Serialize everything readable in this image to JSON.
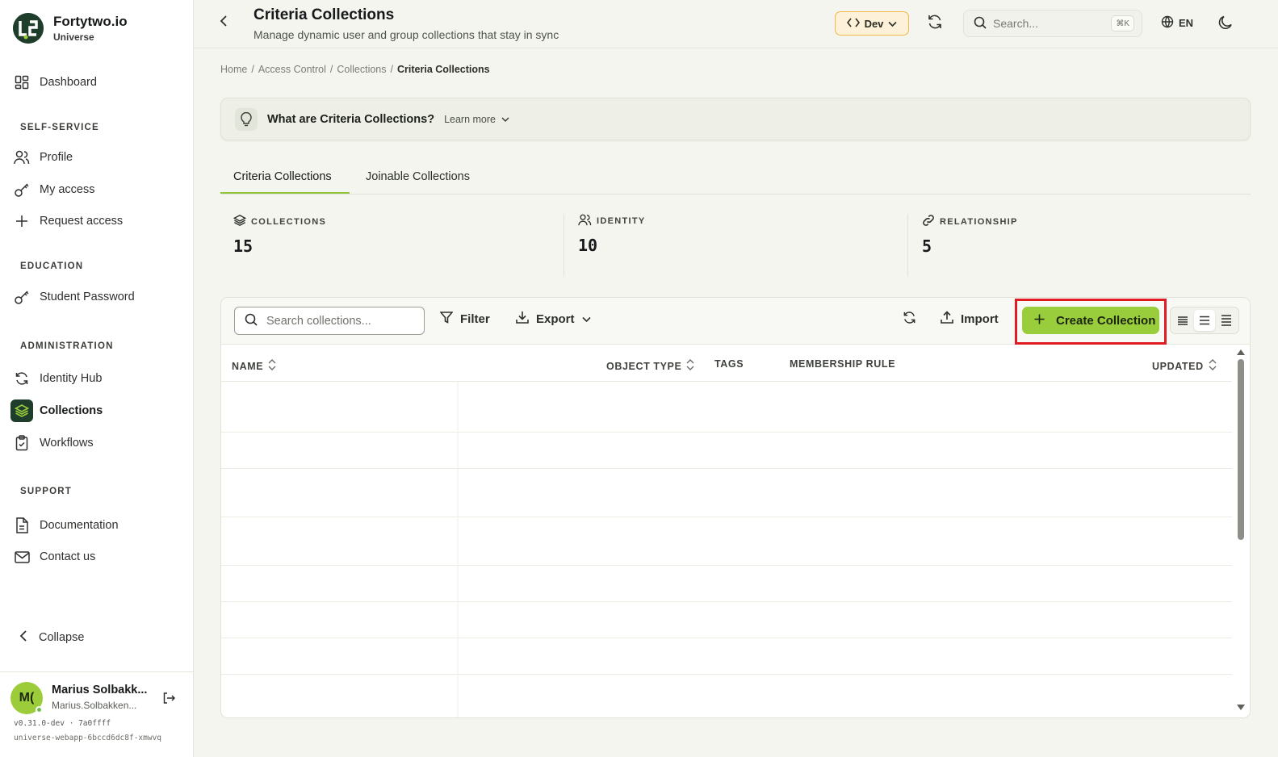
{
  "brand": {
    "name": "Fortytwo.io",
    "sub": "Universe"
  },
  "sidebar": {
    "dashboard": "Dashboard",
    "sections": {
      "self_service": "SELF-SERVICE",
      "education": "EDUCATION",
      "administration": "ADMINISTRATION",
      "support": "SUPPORT"
    },
    "items": {
      "profile": "Profile",
      "my_access": "My access",
      "request_access": "Request access",
      "student_password": "Student Password",
      "identity_hub": "Identity Hub",
      "collections": "Collections",
      "workflows": "Workflows",
      "documentation": "Documentation",
      "contact_us": "Contact us"
    },
    "active": "collections",
    "collapse": "Collapse"
  },
  "user": {
    "initials": "M(",
    "name": "Marius Solbakk...",
    "email": "Marius.Solbakken...",
    "version": "v0.31.0-dev · 7a0ffff",
    "host": "universe-webapp-6bccd6dc8f-xmwvq"
  },
  "header": {
    "title": "Criteria Collections",
    "subtitle": "Manage dynamic user and group collections that stay in sync",
    "env": "Dev",
    "search_placeholder": "Search...",
    "shortcut": "⌘K",
    "lang": "EN"
  },
  "breadcrumb": {
    "home": "Home",
    "access_control": "Access Control",
    "collections": "Collections",
    "current": "Criteria Collections",
    "sep": "/"
  },
  "banner": {
    "question": "What are Criteria Collections?",
    "learn_more": "Learn more"
  },
  "tabs": {
    "criteria": "Criteria Collections",
    "joinable": "Joinable Collections"
  },
  "stats": {
    "collections": {
      "label": "COLLECTIONS",
      "value": "15"
    },
    "identity": {
      "label": "IDENTITY",
      "value": "10"
    },
    "relationship": {
      "label": "RELATIONSHIP",
      "value": "5"
    }
  },
  "toolbar": {
    "search_placeholder": "Search collections...",
    "filter": "Filter",
    "export": "Export",
    "import": "Import",
    "create": "Create Collection"
  },
  "table": {
    "columns": {
      "name": "NAME",
      "object_type": "OBJECT TYPE",
      "tags": "TAGS",
      "membership_rule": "MEMBERSHIP RULE",
      "updated": "UPDATED"
    }
  },
  "colors": {
    "accent": "#9acd3c",
    "brand_dark": "#1f3d2b",
    "highlight": "#e01b24",
    "env_border": "#f0b94a"
  }
}
